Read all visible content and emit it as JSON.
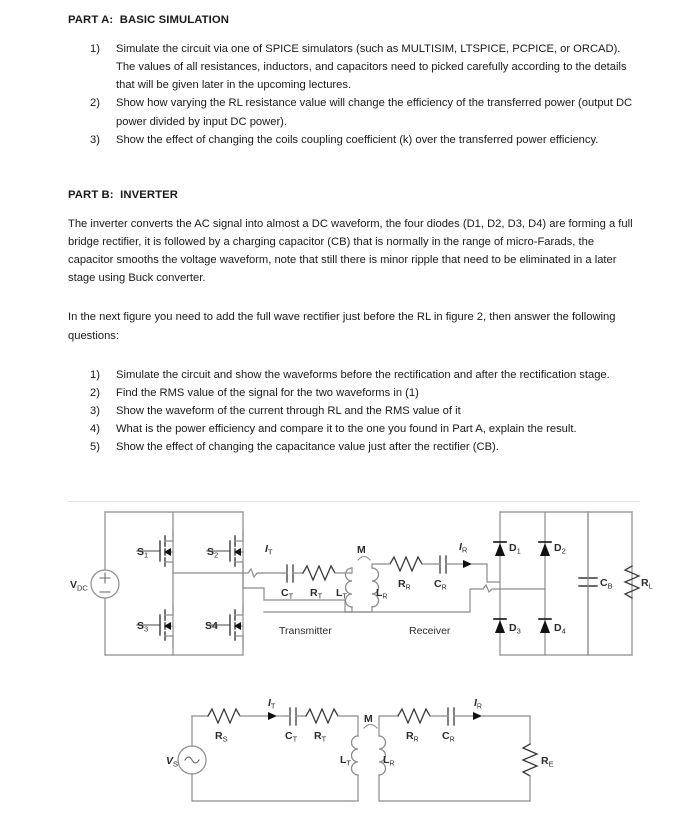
{
  "document": {
    "part_a": {
      "heading": "PART A:  BASIC SIMULATION",
      "items": [
        {
          "num": "1)",
          "text": "Simulate the circuit via one of SPICE simulators (such as MULTISIM, LTSPICE, PCPICE, or ORCAD). The values of all resistances, inductors, and capacitors need to picked carefully according to the details that will be given later in the upcoming lectures."
        },
        {
          "num": "2)",
          "text": "Show how varying the RL resistance value will change the efficiency of the transferred power (output DC power divided by input DC power)."
        },
        {
          "num": "3)",
          "text": "Show the effect of changing the coils coupling coefficient (k) over the transferred power efficiency."
        }
      ]
    },
    "part_b": {
      "heading": "PART B:  INVERTER",
      "intro": "The inverter converts the AC signal into almost a DC waveform, the four diodes (D1, D2, D3, D4) are forming a full bridge rectifier, it is followed by a charging capacitor (CB) that is normally in the range of micro-Farads, the capacitor smooths the voltage waveform, note that still there is minor ripple that need to be eliminated in a later stage using Buck converter.",
      "lead_in": "In the next figure you need to add the full wave rectifier just before the RL in figure 2, then answer the following questions:",
      "items": [
        {
          "num": "1)",
          "text": "Simulate the circuit and show the waveforms before the rectification and after the rectification stage."
        },
        {
          "num": "2)",
          "text": "Find the RMS value of the signal for the two waveforms in (1)"
        },
        {
          "num": "3)",
          "text": "Show the waveform of the current through RL and the RMS value of it"
        },
        {
          "num": "4)",
          "text": "What is the power efficiency and compare it to the one you found in Part A, explain the result."
        },
        {
          "num": "5)",
          "text": "Show the effect of changing the capacitance value just after the rectifier (CB)."
        }
      ]
    }
  },
  "figure_top": {
    "name": "inverter-wireless-power-rectifier-circuit",
    "labels": {
      "vdc": "V",
      "vdc_sub": "DC",
      "plus": "+",
      "minus": "–",
      "s1": "S",
      "s1_sub": "1",
      "s2": "S",
      "s2_sub": "2",
      "s3": "S",
      "s3_sub": "3",
      "s4": "S4",
      "it": "I",
      "it_sub": "T",
      "ct": "C",
      "ct_sub": "T",
      "rt": "R",
      "rt_sub": "T",
      "lt": "L",
      "lt_sub": "T",
      "m": "M",
      "lr": "L",
      "lr_sub": "R",
      "rr": "R",
      "rr_sub": "R",
      "cr": "C",
      "cr_sub": "R",
      "ir": "I",
      "ir_sub": "R",
      "d1": "D",
      "d1_sub": "1",
      "d2": "D",
      "d2_sub": "2",
      "d3": "D",
      "d3_sub": "3",
      "d4": "D",
      "d4_sub": "4",
      "cb": "C",
      "cb_sub": "B",
      "rl": "R",
      "rl_sub": "L",
      "transmitter": "Transmitter",
      "receiver": "Receiver"
    }
  },
  "figure_bottom": {
    "name": "series-series-resonant-wireless-power-circuit",
    "labels": {
      "vs": "V",
      "vs_sub": "S",
      "rs": "R",
      "rs_sub": "S",
      "it": "I",
      "it_sub": "T",
      "ct": "C",
      "ct_sub": "T",
      "rt": "R",
      "rt_sub": "T",
      "lt": "L",
      "lt_sub": "T",
      "m": "M",
      "lr": "L",
      "lr_sub": "R",
      "rr": "R",
      "rr_sub": "R",
      "cr": "C",
      "cr_sub": "R",
      "ir": "I",
      "ir_sub": "R",
      "re": "R",
      "re_sub": "E"
    }
  },
  "colors": {
    "text": "#1a1a1a",
    "wire": "#8c8c8c",
    "wire_dark": "#6d6d6d",
    "device": "#3a3a3a",
    "divider": "#e4e4e4"
  }
}
